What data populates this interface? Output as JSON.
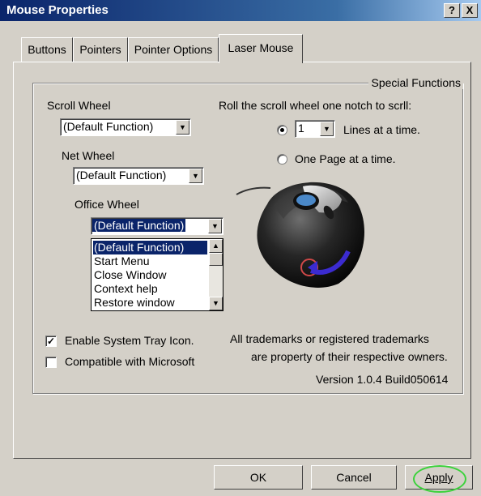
{
  "window": {
    "title": "Mouse Properties",
    "help_label": "?",
    "close_label": "X"
  },
  "tabs": [
    {
      "label": "Buttons"
    },
    {
      "label": "Pointers"
    },
    {
      "label": "Pointer Options"
    },
    {
      "label": "Laser Mouse",
      "active": true
    }
  ],
  "group": {
    "title": "Special Functions"
  },
  "scroll_wheel": {
    "label": "Scroll Wheel",
    "value": "(Default Function)"
  },
  "net_wheel": {
    "label": "Net Wheel",
    "value": "(Default Function)"
  },
  "office_wheel": {
    "label": "Office Wheel",
    "value": "(Default Function)",
    "options": [
      "(Default Function)",
      "Start Menu",
      "Close Window",
      "Context help",
      "Restore window"
    ]
  },
  "scroll_setting": {
    "label": "Roll the scroll wheel one notch to scrll:",
    "lines_value": "1",
    "lines_label": "Lines at a time.",
    "page_label": "One Page at a time.",
    "selected": "lines"
  },
  "options": {
    "tray_icon": {
      "label": "Enable System Tray Icon.",
      "checked": true
    },
    "compatible": {
      "label": "Compatible with Microsoft",
      "checked": false
    }
  },
  "info": {
    "trademark_line1": "All trademarks or registered trademarks",
    "trademark_line2": "are property of their respective owners.",
    "version": "Version 1.0.4 Build050614"
  },
  "buttons": {
    "ok": "OK",
    "cancel": "Cancel",
    "apply": "Apply"
  },
  "icons": {
    "dropdown": "chevron-down-icon",
    "scroll_up": "scroll-up-icon",
    "scroll_down": "scroll-down-icon",
    "check": "checkmark-icon"
  },
  "colors": {
    "titlebar": "#0a246a",
    "selection": "#0a246a",
    "apply_highlight": "#3cd23c",
    "dialog_bg": "#d4d0c8"
  }
}
